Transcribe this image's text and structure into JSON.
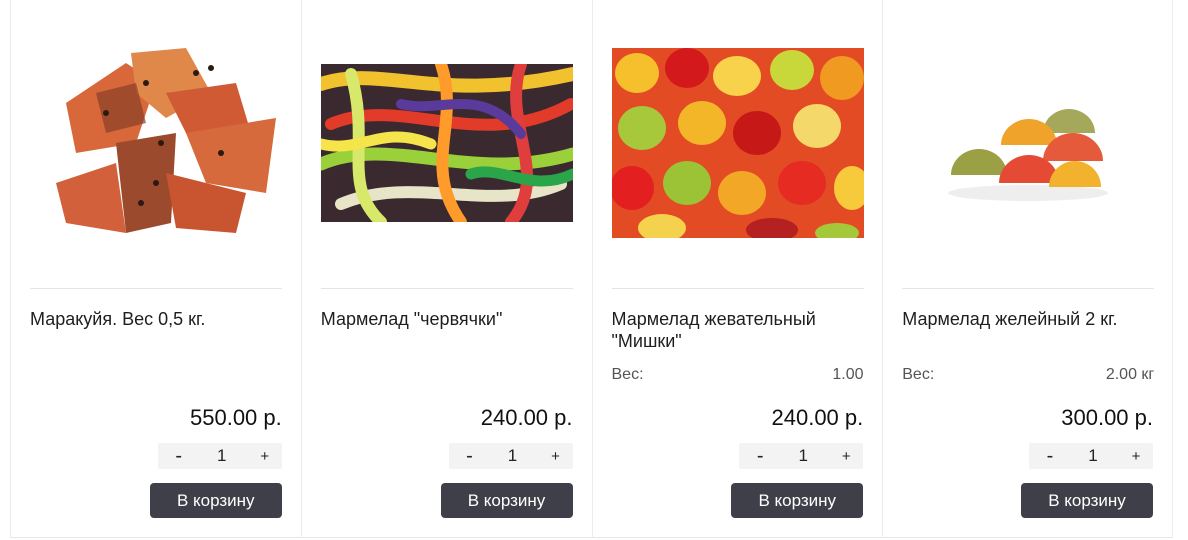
{
  "products": [
    {
      "title": "Маракуйя. Вес 0,5 кг.",
      "image": "passion-fruit-candy-image",
      "attr_label": "",
      "attr_value": "",
      "price": "550.00 р.",
      "qty_minus": "-",
      "qty_value": "1",
      "qty_plus": "+",
      "cart_label": "В корзину"
    },
    {
      "title": "Мармелад \"червячки\"",
      "image": "gummy-worms-image",
      "attr_label": "",
      "attr_value": "",
      "price": "240.00 р.",
      "qty_minus": "-",
      "qty_value": "1",
      "qty_plus": "+",
      "cart_label": "В корзину"
    },
    {
      "title": "Мармелад жевательный \"Мишки\"",
      "image": "gummy-bears-image",
      "attr_label": "Вес:",
      "attr_value": "1.00",
      "price": "240.00 р.",
      "qty_minus": "-",
      "qty_value": "1",
      "qty_plus": "+",
      "cart_label": "В корзину"
    },
    {
      "title": "Мармелад желейный 2 кг.",
      "image": "jelly-candies-image",
      "attr_label": "Вес:",
      "attr_value": "2.00 кг",
      "price": "300.00 р.",
      "qty_minus": "-",
      "qty_value": "1",
      "qty_plus": "+",
      "cart_label": "В корзину"
    }
  ],
  "colors": {
    "button_bg": "#3f3f4a",
    "qty_bg": "#f3f3f3"
  }
}
